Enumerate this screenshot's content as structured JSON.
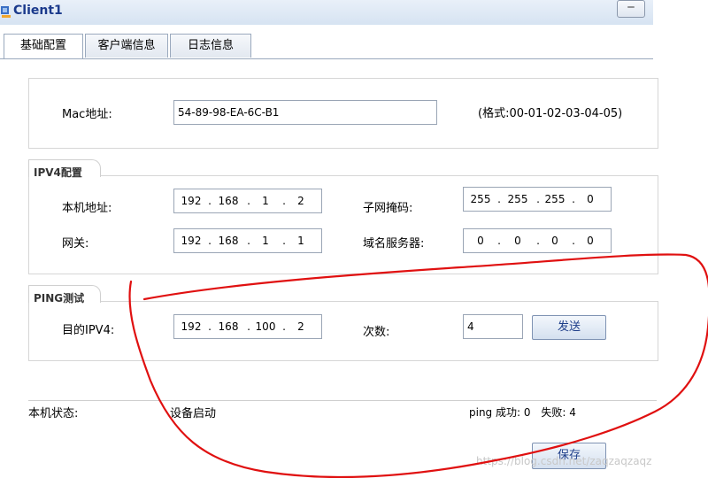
{
  "window": {
    "title": "Client1",
    "minimize_glyph": "‒"
  },
  "tabs": [
    {
      "label": "基础配置"
    },
    {
      "label": "客户端信息"
    },
    {
      "label": "日志信息"
    }
  ],
  "mac": {
    "label": "Mac地址:",
    "value": "54-89-98-EA-6C-B1",
    "format_hint": "(格式:00-01-02-03-04-05)"
  },
  "ipv4": {
    "legend": "IPV4配置",
    "host_label": "本机地址:",
    "host_ip": [
      "192",
      "168",
      "1",
      "2"
    ],
    "mask_label": "子网掩码:",
    "mask_ip": [
      "255",
      "255",
      "255",
      "0"
    ],
    "gateway_label": "网关:",
    "gateway_ip": [
      "192",
      "168",
      "1",
      "1"
    ],
    "dns_label": "域名服务器:",
    "dns_ip": [
      "0",
      "0",
      "0",
      "0"
    ]
  },
  "ping": {
    "legend": "PING测试",
    "dest_label": "目的IPV4:",
    "dest_ip": [
      "192",
      "168",
      "100",
      "2"
    ],
    "count_label": "次数:",
    "count_value": "4",
    "send_button": "发送"
  },
  "status": {
    "label": "本机状态:",
    "value": "设备启动",
    "ping_success_label": "ping 成功:",
    "ping_success": "0",
    "ping_fail_label": "失败:",
    "ping_fail": "4"
  },
  "save_button": "保存",
  "watermark": "https://blog.csdn.net/zaqzaqzaqz",
  "colors": {
    "annotation": "#e01010",
    "title": "#1b3a8c",
    "button_text": "#1f3f8a"
  }
}
